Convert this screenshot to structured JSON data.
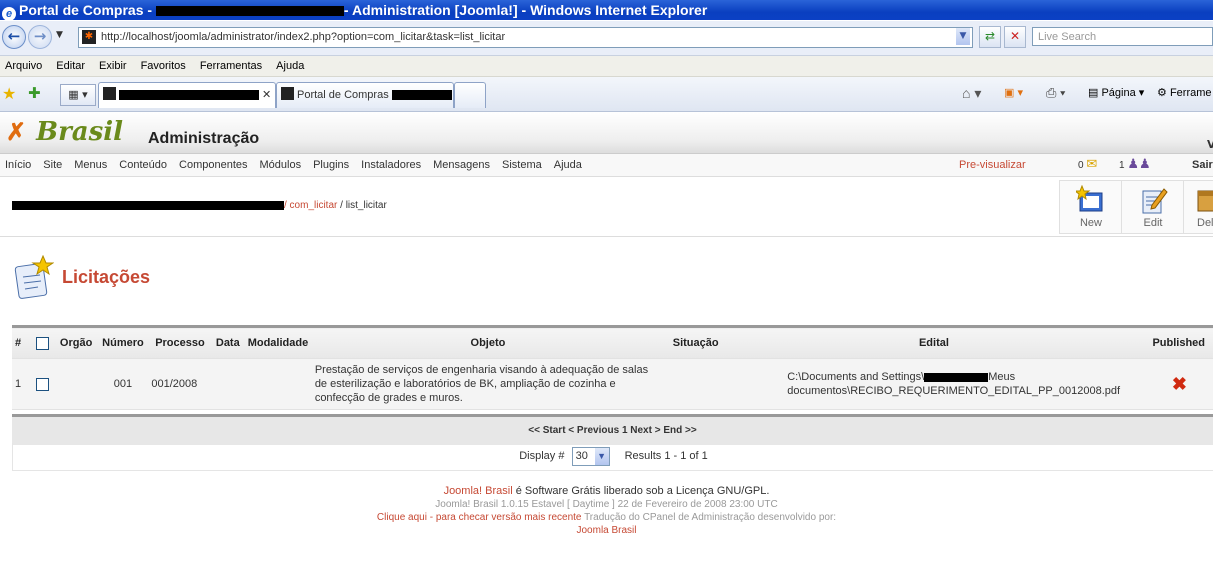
{
  "window": {
    "title_prefix": "Portal de Compras - ",
    "title_suffix": "- Administration [Joomla!] - Windows Internet Explorer"
  },
  "browser": {
    "url": "http://localhost/joomla/administrator/index2.php?option=com_licitar&task=list_licitar",
    "search_placeholder": "Live Search",
    "menu": [
      "Arquivo",
      "Editar",
      "Exibir",
      "Favoritos",
      "Ferramentas",
      "Ajuda"
    ],
    "tab2_label": "Portal de Compras",
    "page_label": "Página",
    "tools_label": "Ferrame"
  },
  "joomla": {
    "logo_text": "Brasil",
    "admin_title": "Administração",
    "menu": [
      "Início",
      "Site",
      "Menus",
      "Conteúdo",
      "Componentes",
      "Módulos",
      "Plugins",
      "Instaladores",
      "Mensagens",
      "Sistema",
      "Ajuda"
    ],
    "preview_label": "Pre-visualizar",
    "messages_count": "0",
    "users_count": "1",
    "logout_label": "Sair",
    "pathway_component": "/ com_licitar",
    "pathway_task": "/ list_licitar",
    "toolbar": {
      "new": "New",
      "edit": "Edit",
      "delete": "Del"
    }
  },
  "section": {
    "title": "Licitações"
  },
  "table": {
    "headers": {
      "num": "#",
      "orgao": "Orgão",
      "numero": "Número",
      "processo": "Processo",
      "data": "Data",
      "modalidade": "Modalidade",
      "objeto": "Objeto",
      "situacao": "Situação",
      "edital": "Edital",
      "published": "Published"
    },
    "rows": [
      {
        "num": "1",
        "numero": "001",
        "processo": "001/2008",
        "objeto": "Prestação de serviços de engenharia visando à adequação de salas de esterilização e laboratórios de BK, ampliação de cozinha e confecção de grades e muros.",
        "edital_prefix": "C:\\Documents and Settings\\",
        "edital_suffix": "Meus documentos\\RECIBO_REQUERIMENTO_EDITAL_PP_0012008.pdf"
      }
    ]
  },
  "pagination": {
    "nav": "<< Start < Previous 1 Next > End >>",
    "display_label": "Display #",
    "limit_value": "30",
    "results": "Results 1 - 1 of 1"
  },
  "footer": {
    "line1_link": "Joomla! Brasil",
    "line1_text": " é Software Grátis liberado sob a Licença GNU/GPL.",
    "line2": "Joomla! Brasil 1.0.15 Estavel [ Daytime ] 22 de Fevereiro de 2008 23:00 UTC",
    "line3_link": "Clique aqui - para checar versão mais recente",
    "line3_text": " Tradução do CPanel de Administração desenvolvido por:",
    "line4_link": "Joomla Brasil"
  },
  "colors": {
    "accent_red": "#c64934",
    "title_bar_blue": "#0a3fc0"
  }
}
